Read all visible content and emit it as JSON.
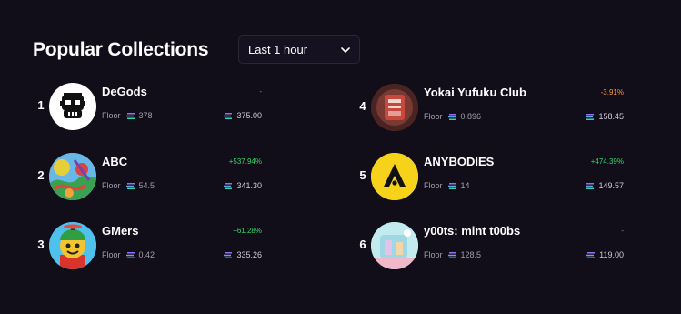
{
  "header": {
    "title": "Popular Collections"
  },
  "filter": {
    "selected": "Last 1 hour"
  },
  "labels": {
    "floor": "Floor"
  },
  "colors": {
    "positive": "#36d46a",
    "negative": "#f0993a",
    "neutral": "#8f8a99"
  },
  "collections": [
    {
      "rank": "1",
      "name": "DeGods",
      "floor": "378",
      "change": "-",
      "change_type": "neutral",
      "volume": "375.00",
      "avatar": "skull-logo"
    },
    {
      "rank": "2",
      "name": "ABC",
      "floor": "54.5",
      "change": "+537.94%",
      "change_type": "positive",
      "volume": "341.30",
      "avatar": "colorful-art"
    },
    {
      "rank": "3",
      "name": "GMers",
      "floor": "0.42",
      "change": "+61.28%",
      "change_type": "positive",
      "volume": "335.26",
      "avatar": "cartoon-character"
    },
    {
      "rank": "4",
      "name": "Yokai Yufuku Club",
      "floor": "0.896",
      "change": "-3.91%",
      "change_type": "negative",
      "volume": "158.45",
      "avatar": "red-yokai-art"
    },
    {
      "rank": "5",
      "name": "ANYBODIES",
      "floor": "14",
      "change": "+474.39%",
      "change_type": "positive",
      "volume": "149.57",
      "avatar": "yellow-a-logo"
    },
    {
      "rank": "6",
      "name": "y00ts: mint t00bs",
      "floor": "128.5",
      "change": "-",
      "change_type": "neutral",
      "volume": "119.00",
      "avatar": "pastel-scene"
    }
  ]
}
